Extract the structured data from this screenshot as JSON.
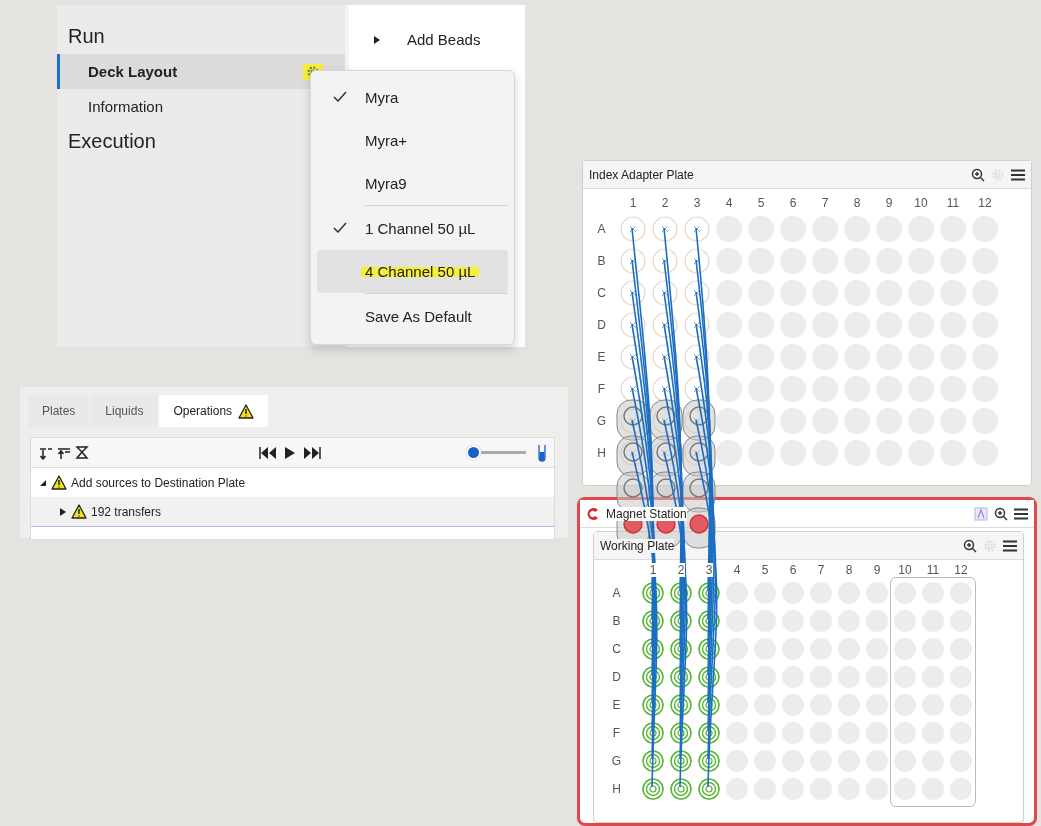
{
  "settings_panel": {
    "sections": [
      {
        "title": "Run",
        "items": [
          {
            "label": "Deck Layout",
            "selected": true
          },
          {
            "label": "Information",
            "selected": false
          }
        ]
      },
      {
        "title": "Execution"
      }
    ],
    "settings_button": {
      "highlighted": true
    },
    "steps": [
      {
        "label": "Add Beads"
      }
    ],
    "deck_menu": {
      "items": [
        {
          "kind": "option",
          "label": "Myra",
          "checked": true,
          "hovered": false,
          "highlighted": false
        },
        {
          "kind": "option",
          "label": "Myra+",
          "checked": false,
          "hovered": false,
          "highlighted": false
        },
        {
          "kind": "option",
          "label": "Myra9",
          "checked": false,
          "hovered": false,
          "highlighted": false
        },
        {
          "kind": "separator"
        },
        {
          "kind": "option",
          "label": "1 Channel 50 µL",
          "checked": true,
          "hovered": false,
          "highlighted": false
        },
        {
          "kind": "option",
          "label": "4 Channel 50 µL",
          "checked": false,
          "hovered": true,
          "highlighted": true
        },
        {
          "kind": "separator"
        },
        {
          "kind": "action",
          "label": "Save As Default"
        }
      ]
    }
  },
  "operations_panel": {
    "tabs": [
      {
        "label": "Plates",
        "selected": false,
        "warning": false
      },
      {
        "label": "Liquids",
        "selected": false,
        "warning": false
      },
      {
        "label": "Operations",
        "selected": true,
        "warning": true
      }
    ],
    "speed_slider": {
      "level": 0
    },
    "tree": [
      {
        "label": "Add sources to Destination Plate",
        "warning": true,
        "expanded": true,
        "selected": false,
        "children": [
          {
            "label": "192 transfers",
            "warning": true,
            "expanded": false,
            "selected": true
          }
        ]
      }
    ]
  },
  "index_plate": {
    "title": "Index Adapter Plate",
    "rows": [
      "A",
      "B",
      "C",
      "D",
      "E",
      "F",
      "G",
      "H"
    ],
    "columns": [
      {
        "label": "1",
        "used": true
      },
      {
        "label": "2",
        "used": true
      },
      {
        "label": "3",
        "used": true
      },
      {
        "label": "4",
        "used": false
      },
      {
        "label": "5",
        "used": false
      },
      {
        "label": "6",
        "used": false
      },
      {
        "label": "7",
        "used": false
      },
      {
        "label": "8",
        "used": false
      },
      {
        "label": "9",
        "used": false
      },
      {
        "label": "10",
        "used": false
      },
      {
        "label": "11",
        "used": false
      },
      {
        "label": "12",
        "used": false
      }
    ]
  },
  "magnet_station": {
    "title": "Magnet Station",
    "working_plate": {
      "title": "Working Plate",
      "rows": [
        "A",
        "B",
        "C",
        "D",
        "E",
        "F",
        "G",
        "H"
      ],
      "columns": [
        {
          "label": "1",
          "used": true,
          "framed": false
        },
        {
          "label": "2",
          "used": true,
          "framed": false
        },
        {
          "label": "3",
          "used": true,
          "framed": false
        },
        {
          "label": "4",
          "used": false,
          "framed": false
        },
        {
          "label": "5",
          "used": false,
          "framed": false
        },
        {
          "label": "6",
          "used": false,
          "framed": false
        },
        {
          "label": "7",
          "used": false,
          "framed": false
        },
        {
          "label": "8",
          "used": false,
          "framed": false
        },
        {
          "label": "9",
          "used": false,
          "framed": false
        },
        {
          "label": "10",
          "used": false,
          "framed": true
        },
        {
          "label": "11",
          "used": false,
          "framed": true
        },
        {
          "label": "12",
          "used": false,
          "framed": true
        }
      ]
    }
  }
}
